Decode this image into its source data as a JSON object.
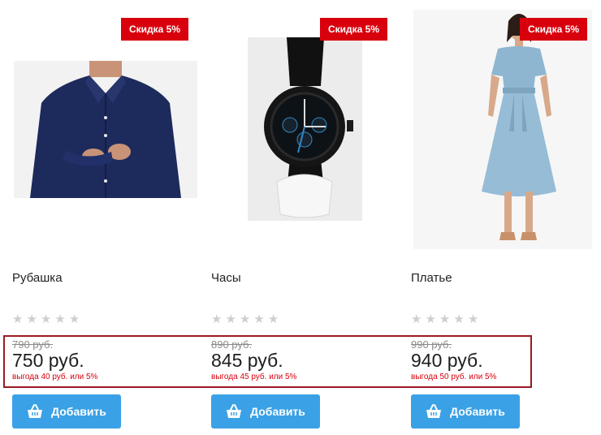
{
  "theme": {
    "accent": "#3aa1e6",
    "discount_red": "#d9000d",
    "highlight_border": "#9a1b22",
    "star_gray": "#cfcfcf"
  },
  "products": [
    {
      "name": "Рубашка",
      "badge": "Скидка 5%",
      "image_icon": "shirt-photo",
      "rating_stars": [
        "★",
        "★",
        "★",
        "★",
        "★"
      ],
      "rating_filled": 0,
      "old_price": "790 руб.",
      "new_price": "750 руб.",
      "savings": "выгода 40 руб. или 5%",
      "add_label": "Добавить"
    },
    {
      "name": "Часы",
      "badge": "Скидка 5%",
      "image_icon": "watch-photo",
      "rating_stars": [
        "★",
        "★",
        "★",
        "★",
        "★"
      ],
      "rating_filled": 0,
      "old_price": "890 руб.",
      "new_price": "845 руб.",
      "savings": "выгода 45 руб. или 5%",
      "add_label": "Добавить"
    },
    {
      "name": "Платье",
      "badge": "Скидка 5%",
      "image_icon": "dress-photo",
      "rating_stars": [
        "★",
        "★",
        "★",
        "★",
        "★"
      ],
      "rating_filled": 0,
      "old_price": "990 руб.",
      "new_price": "940 руб.",
      "savings": "выгода 50 руб. или 5%",
      "add_label": "Добавить"
    }
  ]
}
